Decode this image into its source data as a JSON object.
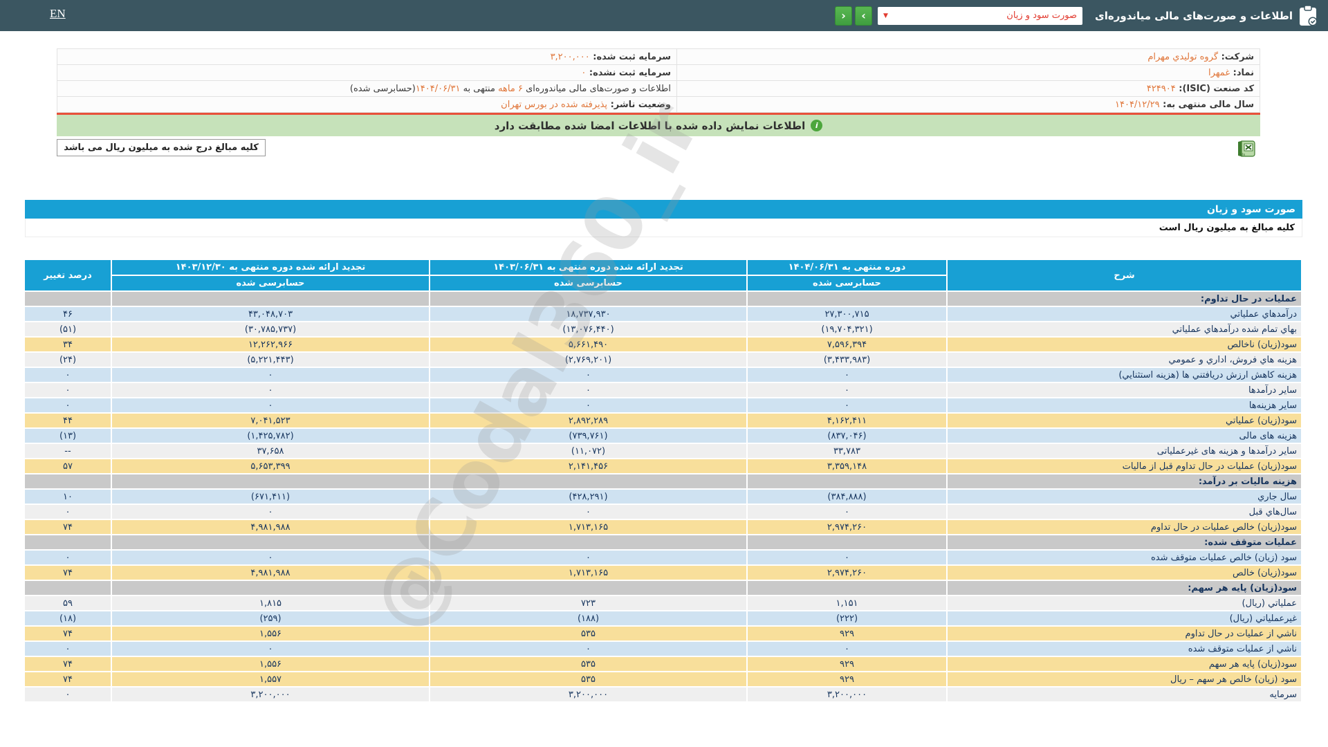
{
  "colors": {
    "topbar_bg": "#3b5661",
    "accent_cyan": "#18a0d4",
    "row_blue": "#cfe2f1",
    "row_gray": "#efefef",
    "row_yellow": "#f8df9b",
    "row_section": "#c9c9c9",
    "value_navy": "#17355e",
    "value_negative_red": "#d8342c",
    "info_value_orange": "#e0763a",
    "banner_green": "#c6e2ba",
    "button_green": "#4ca64c",
    "divider_red": "#e8503a"
  },
  "watermark": "@Codal360_ir",
  "topbar": {
    "en_label": "EN",
    "title": "اطلاعات و صورت‌های مالی میاندوره‌ای",
    "dropdown_value": "صورت سود و زیان",
    "dropdown_chevron": "▼",
    "forward_icon": "›",
    "back_icon": "‹"
  },
  "info": {
    "rows": [
      {
        "right": [
          {
            "t": "شرکت:  ",
            "b": 1
          },
          {
            "t": "گروه توليدي مهرام",
            "o": 1
          }
        ],
        "left": [
          {
            "t": "سرمایه ثبت شده:  ",
            "b": 1
          },
          {
            "t": "۳,۲۰۰,۰۰۰",
            "o": 1
          }
        ]
      },
      {
        "right": [
          {
            "t": "نماد:  ",
            "b": 1
          },
          {
            "t": "غمهرا",
            "o": 1
          }
        ],
        "left": [
          {
            "t": "سرمایه ثبت نشده:  ",
            "b": 1
          },
          {
            "t": "۰",
            "o": 1
          }
        ]
      },
      {
        "right": [
          {
            "t": "کد صنعت (ISIC):  ",
            "b": 1
          },
          {
            "t": "۴۲۴۹۰۴",
            "o": 1
          }
        ],
        "left": [
          {
            "t": "اطلاعات و صورت‌های مالی میاندوره‌ای "
          },
          {
            "t": "۶ ماهه",
            "o": 1
          },
          {
            "t": " منتهی به "
          },
          {
            "t": "۱۴۰۴/۰۶/۳۱",
            "o": 1
          },
          {
            "t": "(حسابرسی شده)"
          }
        ]
      },
      {
        "right": [
          {
            "t": "سال مالی منتهی به:  ",
            "b": 1
          },
          {
            "t": "۱۴۰۴/۱۲/۲۹",
            "o": 1
          }
        ],
        "left": [
          {
            "t": "وضعیت ناشر:  ",
            "b": 1
          },
          {
            "t": "پذیرفته شده در بورس تهران",
            "o": 1
          }
        ]
      }
    ]
  },
  "banner": {
    "icon": "i",
    "text": "اطلاعات نمایش داده شده با اطلاعات امضا شده مطابقت دارد"
  },
  "unit_note_box": "کلیه مبالغ درج شده به میلیون ریال می باشد",
  "statement": {
    "title": "صورت سود و زیان",
    "unit_note": "کلیه مبالغ به میلیون ریال است",
    "header": {
      "sharh": "شرح",
      "cols": [
        {
          "title": "دوره منتهی به ۱۴۰۴/۰۶/۳۱",
          "sub": "حسابرسی شده"
        },
        {
          "title": "تجدید ارائه شده دوره منتهی به ۱۴۰۳/۰۶/۳۱",
          "sub": "حسابرسی شده"
        },
        {
          "title": "تجدید ارائه شده دوره منتهی به ۱۴۰۳/۱۲/۳۰",
          "sub": "حسابرسی شده"
        }
      ],
      "percent": "درصد تغییر"
    },
    "rows": [
      {
        "t": "s",
        "label": "عملیات در حال تداوم:"
      },
      {
        "t": "d",
        "bg": "b",
        "label": "درآمدهاي عملياتي",
        "v": [
          "۲۷,۳۰۰,۷۱۵",
          "۱۸,۷۳۷,۹۳۰",
          "۴۳,۰۴۸,۷۰۳"
        ],
        "p": "۴۶"
      },
      {
        "t": "d",
        "bg": "g",
        "label": "بهاي تمام شده درآمدهاي عملياتي",
        "v": [
          "(۱۹,۷۰۴,۳۲۱)",
          "(۱۳,۰۷۶,۴۴۰)",
          "(۳۰,۷۸۵,۷۳۷)"
        ],
        "p": "(۵۱)"
      },
      {
        "t": "d",
        "bg": "y",
        "label": "سود(زيان) ناخالص",
        "v": [
          "۷,۵۹۶,۳۹۴",
          "۵,۶۶۱,۴۹۰",
          "۱۲,۲۶۲,۹۶۶"
        ],
        "p": "۳۴"
      },
      {
        "t": "d",
        "bg": "g",
        "label": "هزينه هاي فروش، اداري و عمومي",
        "v": [
          "(۳,۴۳۳,۹۸۳)",
          "(۲,۷۶۹,۲۰۱)",
          "(۵,۲۲۱,۴۴۳)"
        ],
        "p": "(۲۴)"
      },
      {
        "t": "d",
        "bg": "b",
        "label": "هزینه کاهش ارزش دریافتني ها (هزینه استثنایي)",
        "v": [
          "۰",
          "۰",
          "۰"
        ],
        "p": "۰"
      },
      {
        "t": "d",
        "bg": "g",
        "label": "سایر درآمدها",
        "v": [
          "۰",
          "۰",
          "۰"
        ],
        "p": "۰"
      },
      {
        "t": "d",
        "bg": "b",
        "label": "سایر هزینه‌ها",
        "v": [
          "۰",
          "۰",
          "۰"
        ],
        "p": "۰"
      },
      {
        "t": "d",
        "bg": "y",
        "label": "سود(زيان) عملياتي",
        "v": [
          "۴,۱۶۲,۴۱۱",
          "۲,۸۹۲,۲۸۹",
          "۷,۰۴۱,۵۲۳"
        ],
        "p": "۴۴"
      },
      {
        "t": "d",
        "bg": "b",
        "label": "هزینه های مالی",
        "v": [
          "(۸۳۷,۰۴۶)",
          "(۷۳۹,۷۶۱)",
          "(۱,۴۲۵,۷۸۲)"
        ],
        "p": "(۱۳)"
      },
      {
        "t": "d",
        "bg": "g",
        "label": "سایر درآمدها و هزینه های غیرعملیاتی",
        "v": [
          "۳۳,۷۸۳",
          "(۱۱,۰۷۲)",
          "۳۷,۶۵۸"
        ],
        "p": "--"
      },
      {
        "t": "d",
        "bg": "y",
        "label": "سود(زيان) عملیات در حال تداوم قبل از مالیات",
        "v": [
          "۳,۳۵۹,۱۴۸",
          "۲,۱۴۱,۴۵۶",
          "۵,۶۵۳,۳۹۹"
        ],
        "p": "۵۷"
      },
      {
        "t": "s",
        "label": "هزینه مالیات بر درآمد:"
      },
      {
        "t": "d",
        "bg": "b",
        "label": "سال جاري",
        "v": [
          "(۳۸۴,۸۸۸)",
          "(۴۲۸,۲۹۱)",
          "(۶۷۱,۴۱۱)"
        ],
        "p": "۱۰"
      },
      {
        "t": "d",
        "bg": "g",
        "label": "سال‌هاي قبل",
        "v": [
          "۰",
          "۰",
          "۰"
        ],
        "p": "۰"
      },
      {
        "t": "d",
        "bg": "y",
        "label": "سود(زيان) خالص عملیات در حال تداوم",
        "v": [
          "۲,۹۷۴,۲۶۰",
          "۱,۷۱۳,۱۶۵",
          "۴,۹۸۱,۹۸۸"
        ],
        "p": "۷۴"
      },
      {
        "t": "s",
        "label": "عملیات متوقف شده:"
      },
      {
        "t": "d",
        "bg": "b",
        "label": "سود (زیان) خالص عملیات متوقف شده",
        "v": [
          "۰",
          "۰",
          "۰"
        ],
        "p": "۰"
      },
      {
        "t": "d",
        "bg": "y",
        "label": "سود(زيان) خالص",
        "v": [
          "۲,۹۷۴,۲۶۰",
          "۱,۷۱۳,۱۶۵",
          "۴,۹۸۱,۹۸۸"
        ],
        "p": "۷۴"
      },
      {
        "t": "s",
        "label": "سود(زیان) پایه هر سهم:"
      },
      {
        "t": "d",
        "bg": "g",
        "label": "عملياتي (ريال)",
        "v": [
          "۱,۱۵۱",
          "۷۲۳",
          "۱,۸۱۵"
        ],
        "p": "۵۹"
      },
      {
        "t": "d",
        "bg": "b",
        "label": "غیرعملیاتي (ریال)",
        "v": [
          "(۲۲۲)",
          "(۱۸۸)",
          "(۲۵۹)"
        ],
        "p": "(۱۸)"
      },
      {
        "t": "d",
        "bg": "y",
        "label": "ناشي از عملیات در حال تداوم",
        "v": [
          "۹۲۹",
          "۵۳۵",
          "۱,۵۵۶"
        ],
        "p": "۷۴"
      },
      {
        "t": "d",
        "bg": "b",
        "label": "ناشي از عملیات متوقف شده",
        "v": [
          "۰",
          "۰",
          "۰"
        ],
        "p": "۰"
      },
      {
        "t": "d",
        "bg": "y",
        "label": "سود(زيان) پايه هر سهم",
        "v": [
          "۹۲۹",
          "۵۳۵",
          "۱,۵۵۶"
        ],
        "p": "۷۴"
      },
      {
        "t": "d",
        "bg": "y",
        "label": "سود (زيان) خالص هر سهم – ريال",
        "v": [
          "۹۲۹",
          "۵۳۵",
          "۱,۵۵۷"
        ],
        "p": "۷۴"
      },
      {
        "t": "d",
        "bg": "g",
        "label": "سرمايه",
        "v": [
          "۳,۲۰۰,۰۰۰",
          "۳,۲۰۰,۰۰۰",
          "۳,۲۰۰,۰۰۰"
        ],
        "p": "۰"
      }
    ]
  }
}
